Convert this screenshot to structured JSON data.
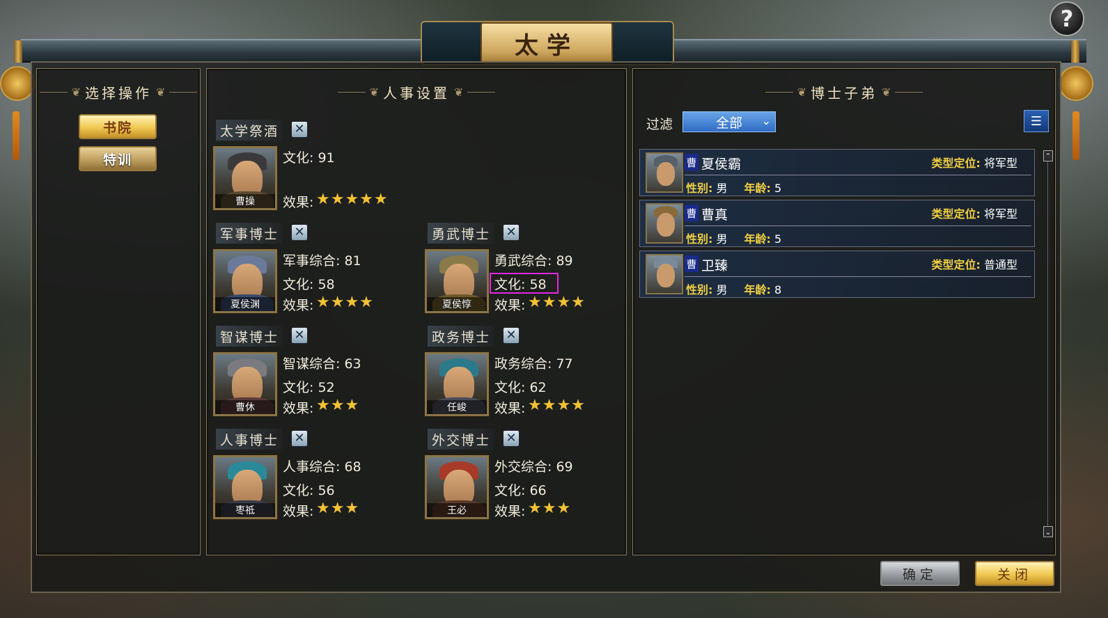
{
  "header": {
    "title": "太学",
    "help_icon": "?"
  },
  "left_panel": {
    "title": "选择操作",
    "buttons": [
      {
        "label": "书院",
        "active": true
      },
      {
        "label": "特训",
        "active": false
      }
    ]
  },
  "middle_panel": {
    "title": "人事设置",
    "remove_icon": "✕",
    "slots": {
      "jijiu": {
        "role": "太学祭酒",
        "name": "曹操",
        "culture": "文化: 91",
        "effect_label": "效果:",
        "stars": "★★★★★",
        "rating": 5
      },
      "junshi": {
        "role": "军事博士",
        "name": "夏侯渊",
        "main": "军事综合: 81",
        "culture": "文化: 58",
        "effect_label": "效果:",
        "stars": "★★★★",
        "rating": 4
      },
      "yongwu": {
        "role": "勇武博士",
        "name": "夏侯惇",
        "main": "勇武综合: 89",
        "culture": "文化: 58",
        "effect_label": "效果:",
        "stars": "★★★★",
        "rating": 4
      },
      "zhimou": {
        "role": "智谋博士",
        "name": "曹休",
        "main": "智谋综合: 63",
        "culture": "文化: 52",
        "effect_label": "效果:",
        "stars": "★★★",
        "rating": 3
      },
      "zhengwu": {
        "role": "政务博士",
        "name": "任峻",
        "main": "政务综合: 77",
        "culture": "文化: 62",
        "effect_label": "效果:",
        "stars": "★★★★",
        "rating": 4
      },
      "renshi": {
        "role": "人事博士",
        "name": "枣祗",
        "main": "人事综合: 68",
        "culture": "文化: 56",
        "effect_label": "效果:",
        "stars": "★★★",
        "rating": 3
      },
      "waijiao": {
        "role": "外交博士",
        "name": "王必",
        "main": "外交综合: 69",
        "culture": "文化: 66",
        "effect_label": "效果:",
        "stars": "★★★",
        "rating": 3
      }
    }
  },
  "right_panel": {
    "title": "博士子弟",
    "filter_label": "过滤",
    "filter_value": "全部",
    "list_icon": "☰",
    "students": [
      {
        "clan": "曹",
        "name": "夏侯霸",
        "type_label": "类型定位:",
        "type": "将军型",
        "gender_label": "性别:",
        "gender": "男",
        "age_label": "年龄:",
        "age": "5"
      },
      {
        "clan": "曹",
        "name": "曹真",
        "type_label": "类型定位:",
        "type": "将军型",
        "gender_label": "性别:",
        "gender": "男",
        "age_label": "年龄:",
        "age": "5"
      },
      {
        "clan": "曹",
        "name": "卫臻",
        "type_label": "类型定位:",
        "type": "普通型",
        "gender_label": "性别:",
        "gender": "男",
        "age_label": "年龄:",
        "age": "8"
      }
    ],
    "scroll_up": "⌃",
    "scroll_down": "⌄"
  },
  "footer": {
    "confirm_label": "确定",
    "close_label": "关闭"
  },
  "colors": {
    "gold": "#f0c850",
    "star": "#f3c234",
    "highlight": "#e426e4",
    "clan_bg": "#1a2a8a"
  }
}
